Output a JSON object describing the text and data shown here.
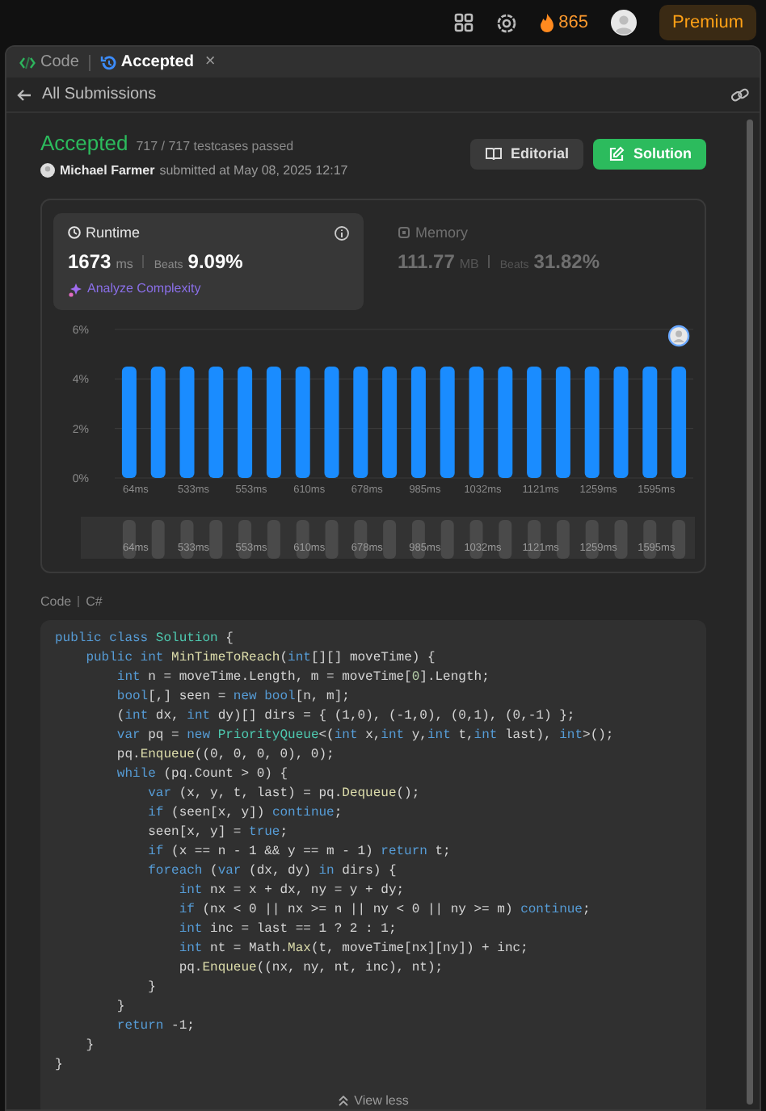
{
  "topbar": {
    "streak": "865",
    "premium": "Premium"
  },
  "tabs": [
    {
      "label": "Code",
      "kind": "code",
      "selected": false,
      "closable": false
    },
    {
      "label": "Accepted",
      "kind": "history",
      "selected": true,
      "closable": true
    }
  ],
  "close_glyph": "×",
  "back_link": "All Submissions",
  "result": {
    "status": "Accepted",
    "testcases": "717 / 717 testcases passed",
    "user": "Michael Farmer",
    "submitted": "submitted at May 08, 2025 12:17"
  },
  "buttons": [
    {
      "label": "Editorial",
      "kind": "editorial"
    },
    {
      "label": "Solution",
      "kind": "solution"
    }
  ],
  "metrics": [
    {
      "title": "Runtime",
      "value": "1673",
      "unit": "ms",
      "beats_label": "Beats",
      "beats": "9.09%",
      "selected": true,
      "link": "Analyze Complexity"
    },
    {
      "title": "Memory",
      "value": "111.77",
      "unit": "MB",
      "beats_label": "Beats",
      "beats": "31.82%",
      "selected": false
    }
  ],
  "chart_data": {
    "type": "bar",
    "categories": [
      "64ms",
      null,
      "533ms",
      null,
      "553ms",
      null,
      "610ms",
      null,
      "678ms",
      null,
      "985ms",
      null,
      "1032ms",
      null,
      "1121ms",
      null,
      "1259ms",
      null,
      "1595ms",
      null
    ],
    "values": [
      4.5,
      4.5,
      4.5,
      4.5,
      4.5,
      4.5,
      4.5,
      4.5,
      4.5,
      4.5,
      4.5,
      4.5,
      4.5,
      4.5,
      4.5,
      4.5,
      4.5,
      4.5,
      4.5,
      4.5
    ],
    "ylim": [
      0,
      6
    ],
    "yticks": [
      {
        "value": 0,
        "label": "0%"
      },
      {
        "value": 2,
        "label": "2%"
      },
      {
        "value": 4,
        "label": "4%"
      },
      {
        "value": 6,
        "label": "6%"
      }
    ]
  },
  "navigator_labels": [
    "64ms",
    "533ms",
    "553ms",
    "610ms",
    "678ms",
    "985ms",
    "1032ms",
    "1121ms",
    "1259ms",
    "1595ms"
  ],
  "code_header": {
    "label": "Code",
    "language": "C#"
  },
  "code_lines": [
    [
      {
        "kind": "keyword",
        "text": "public class "
      },
      {
        "kind": "type",
        "text": "Solution"
      },
      {
        "kind": "plain",
        "text": " {"
      }
    ],
    [
      {
        "kind": "keyword",
        "text": "    public int "
      },
      {
        "kind": "function",
        "text": "MinTimeToReach"
      },
      {
        "kind": "plain",
        "text": "("
      },
      {
        "kind": "keyword",
        "text": "int"
      },
      {
        "kind": "plain",
        "text": "[][] moveTime) {"
      }
    ],
    [
      {
        "kind": "keyword",
        "text": "        int"
      },
      {
        "kind": "plain",
        "text": " n = moveTime.Length, m = moveTime["
      },
      {
        "kind": "number",
        "text": "0"
      },
      {
        "kind": "plain",
        "text": "].Length;"
      }
    ],
    [
      {
        "kind": "keyword",
        "text": "        bool"
      },
      {
        "kind": "plain",
        "text": "[,] seen = "
      },
      {
        "kind": "keyword",
        "text": "new bool"
      },
      {
        "kind": "plain",
        "text": "[n, m];"
      }
    ],
    [
      {
        "kind": "plain",
        "text": "        ("
      },
      {
        "kind": "keyword",
        "text": "int"
      },
      {
        "kind": "plain",
        "text": " dx, "
      },
      {
        "kind": "keyword",
        "text": "int"
      },
      {
        "kind": "plain",
        "text": " dy)[] dirs = { (1,0), (-1,0), (0,1), (0,-1) };"
      }
    ],
    [
      {
        "kind": "keyword",
        "text": "        var"
      },
      {
        "kind": "plain",
        "text": " pq = "
      },
      {
        "kind": "keyword",
        "text": "new "
      },
      {
        "kind": "type",
        "text": "PriorityQueue"
      },
      {
        "kind": "plain",
        "text": "<("
      },
      {
        "kind": "keyword",
        "text": "int"
      },
      {
        "kind": "plain",
        "text": " x,"
      },
      {
        "kind": "keyword",
        "text": "int"
      },
      {
        "kind": "plain",
        "text": " y,"
      },
      {
        "kind": "keyword",
        "text": "int"
      },
      {
        "kind": "plain",
        "text": " t,"
      },
      {
        "kind": "keyword",
        "text": "int"
      },
      {
        "kind": "plain",
        "text": " last), "
      },
      {
        "kind": "keyword",
        "text": "int"
      },
      {
        "kind": "plain",
        "text": ">();"
      }
    ],
    [
      {
        "kind": "plain",
        "text": "        pq."
      },
      {
        "kind": "function",
        "text": "Enqueue"
      },
      {
        "kind": "plain",
        "text": "((0, 0, 0, 0), 0);"
      }
    ],
    [
      {
        "kind": "keyword",
        "text": "        while"
      },
      {
        "kind": "plain",
        "text": " (pq.Count > 0) {"
      }
    ],
    [
      {
        "kind": "keyword",
        "text": "            var"
      },
      {
        "kind": "plain",
        "text": " (x, y, t, last) = pq."
      },
      {
        "kind": "function",
        "text": "Dequeue"
      },
      {
        "kind": "plain",
        "text": "();"
      }
    ],
    [
      {
        "kind": "keyword",
        "text": "            if"
      },
      {
        "kind": "plain",
        "text": " (seen[x, y]) "
      },
      {
        "kind": "keyword",
        "text": "continue"
      },
      {
        "kind": "plain",
        "text": ";"
      }
    ],
    [
      {
        "kind": "plain",
        "text": "            seen[x, y] = "
      },
      {
        "kind": "keyword",
        "text": "true"
      },
      {
        "kind": "plain",
        "text": ";"
      }
    ],
    [
      {
        "kind": "keyword",
        "text": "            if"
      },
      {
        "kind": "plain",
        "text": " (x == n - 1 && y == m - 1) "
      },
      {
        "kind": "keyword",
        "text": "return"
      },
      {
        "kind": "plain",
        "text": " t;"
      }
    ],
    [
      {
        "kind": "keyword",
        "text": "            foreach"
      },
      {
        "kind": "plain",
        "text": " ("
      },
      {
        "kind": "keyword",
        "text": "var"
      },
      {
        "kind": "plain",
        "text": " (dx, dy) "
      },
      {
        "kind": "keyword",
        "text": "in"
      },
      {
        "kind": "plain",
        "text": " dirs) {"
      }
    ],
    [
      {
        "kind": "keyword",
        "text": "                int"
      },
      {
        "kind": "plain",
        "text": " nx = x + dx, ny = y + dy;"
      }
    ],
    [
      {
        "kind": "keyword",
        "text": "                if"
      },
      {
        "kind": "plain",
        "text": " (nx < 0 || nx >= n || ny < 0 || ny >= m) "
      },
      {
        "kind": "keyword",
        "text": "continue"
      },
      {
        "kind": "plain",
        "text": ";"
      }
    ],
    [
      {
        "kind": "keyword",
        "text": "                int"
      },
      {
        "kind": "plain",
        "text": " inc = last == 1 ? 2 : 1;"
      }
    ],
    [
      {
        "kind": "keyword",
        "text": "                int"
      },
      {
        "kind": "plain",
        "text": " nt = Math."
      },
      {
        "kind": "function",
        "text": "Max"
      },
      {
        "kind": "plain",
        "text": "(t, moveTime[nx][ny]) + inc;"
      }
    ],
    [
      {
        "kind": "plain",
        "text": "                pq."
      },
      {
        "kind": "function",
        "text": "Enqueue"
      },
      {
        "kind": "plain",
        "text": "((nx, ny, nt, inc), nt);"
      }
    ],
    [
      {
        "kind": "plain",
        "text": "            }"
      }
    ],
    [
      {
        "kind": "plain",
        "text": "        }"
      }
    ],
    [
      {
        "kind": "keyword",
        "text": "        return"
      },
      {
        "kind": "plain",
        "text": " -1;"
      }
    ],
    [
      {
        "kind": "plain",
        "text": "    }"
      }
    ],
    [
      {
        "kind": "plain",
        "text": "}"
      }
    ]
  ],
  "view_less": "View less"
}
